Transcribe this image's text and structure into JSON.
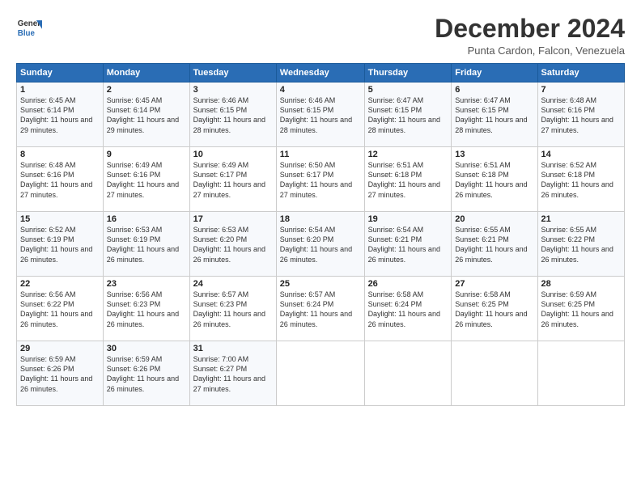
{
  "logo": {
    "general": "General",
    "blue": "Blue"
  },
  "title": "December 2024",
  "subtitle": "Punta Cardon, Falcon, Venezuela",
  "days_of_week": [
    "Sunday",
    "Monday",
    "Tuesday",
    "Wednesday",
    "Thursday",
    "Friday",
    "Saturday"
  ],
  "weeks": [
    [
      {
        "day": "1",
        "sunrise": "6:45 AM",
        "sunset": "6:14 PM",
        "daylight": "11 hours and 29 minutes."
      },
      {
        "day": "2",
        "sunrise": "6:45 AM",
        "sunset": "6:14 PM",
        "daylight": "11 hours and 29 minutes."
      },
      {
        "day": "3",
        "sunrise": "6:46 AM",
        "sunset": "6:15 PM",
        "daylight": "11 hours and 28 minutes."
      },
      {
        "day": "4",
        "sunrise": "6:46 AM",
        "sunset": "6:15 PM",
        "daylight": "11 hours and 28 minutes."
      },
      {
        "day": "5",
        "sunrise": "6:47 AM",
        "sunset": "6:15 PM",
        "daylight": "11 hours and 28 minutes."
      },
      {
        "day": "6",
        "sunrise": "6:47 AM",
        "sunset": "6:15 PM",
        "daylight": "11 hours and 28 minutes."
      },
      {
        "day": "7",
        "sunrise": "6:48 AM",
        "sunset": "6:16 PM",
        "daylight": "11 hours and 27 minutes."
      }
    ],
    [
      {
        "day": "8",
        "sunrise": "6:48 AM",
        "sunset": "6:16 PM",
        "daylight": "11 hours and 27 minutes."
      },
      {
        "day": "9",
        "sunrise": "6:49 AM",
        "sunset": "6:16 PM",
        "daylight": "11 hours and 27 minutes."
      },
      {
        "day": "10",
        "sunrise": "6:49 AM",
        "sunset": "6:17 PM",
        "daylight": "11 hours and 27 minutes."
      },
      {
        "day": "11",
        "sunrise": "6:50 AM",
        "sunset": "6:17 PM",
        "daylight": "11 hours and 27 minutes."
      },
      {
        "day": "12",
        "sunrise": "6:51 AM",
        "sunset": "6:18 PM",
        "daylight": "11 hours and 27 minutes."
      },
      {
        "day": "13",
        "sunrise": "6:51 AM",
        "sunset": "6:18 PM",
        "daylight": "11 hours and 26 minutes."
      },
      {
        "day": "14",
        "sunrise": "6:52 AM",
        "sunset": "6:18 PM",
        "daylight": "11 hours and 26 minutes."
      }
    ],
    [
      {
        "day": "15",
        "sunrise": "6:52 AM",
        "sunset": "6:19 PM",
        "daylight": "11 hours and 26 minutes."
      },
      {
        "day": "16",
        "sunrise": "6:53 AM",
        "sunset": "6:19 PM",
        "daylight": "11 hours and 26 minutes."
      },
      {
        "day": "17",
        "sunrise": "6:53 AM",
        "sunset": "6:20 PM",
        "daylight": "11 hours and 26 minutes."
      },
      {
        "day": "18",
        "sunrise": "6:54 AM",
        "sunset": "6:20 PM",
        "daylight": "11 hours and 26 minutes."
      },
      {
        "day": "19",
        "sunrise": "6:54 AM",
        "sunset": "6:21 PM",
        "daylight": "11 hours and 26 minutes."
      },
      {
        "day": "20",
        "sunrise": "6:55 AM",
        "sunset": "6:21 PM",
        "daylight": "11 hours and 26 minutes."
      },
      {
        "day": "21",
        "sunrise": "6:55 AM",
        "sunset": "6:22 PM",
        "daylight": "11 hours and 26 minutes."
      }
    ],
    [
      {
        "day": "22",
        "sunrise": "6:56 AM",
        "sunset": "6:22 PM",
        "daylight": "11 hours and 26 minutes."
      },
      {
        "day": "23",
        "sunrise": "6:56 AM",
        "sunset": "6:23 PM",
        "daylight": "11 hours and 26 minutes."
      },
      {
        "day": "24",
        "sunrise": "6:57 AM",
        "sunset": "6:23 PM",
        "daylight": "11 hours and 26 minutes."
      },
      {
        "day": "25",
        "sunrise": "6:57 AM",
        "sunset": "6:24 PM",
        "daylight": "11 hours and 26 minutes."
      },
      {
        "day": "26",
        "sunrise": "6:58 AM",
        "sunset": "6:24 PM",
        "daylight": "11 hours and 26 minutes."
      },
      {
        "day": "27",
        "sunrise": "6:58 AM",
        "sunset": "6:25 PM",
        "daylight": "11 hours and 26 minutes."
      },
      {
        "day": "28",
        "sunrise": "6:59 AM",
        "sunset": "6:25 PM",
        "daylight": "11 hours and 26 minutes."
      }
    ],
    [
      {
        "day": "29",
        "sunrise": "6:59 AM",
        "sunset": "6:26 PM",
        "daylight": "11 hours and 26 minutes."
      },
      {
        "day": "30",
        "sunrise": "6:59 AM",
        "sunset": "6:26 PM",
        "daylight": "11 hours and 26 minutes."
      },
      {
        "day": "31",
        "sunrise": "7:00 AM",
        "sunset": "6:27 PM",
        "daylight": "11 hours and 27 minutes."
      },
      null,
      null,
      null,
      null
    ]
  ]
}
